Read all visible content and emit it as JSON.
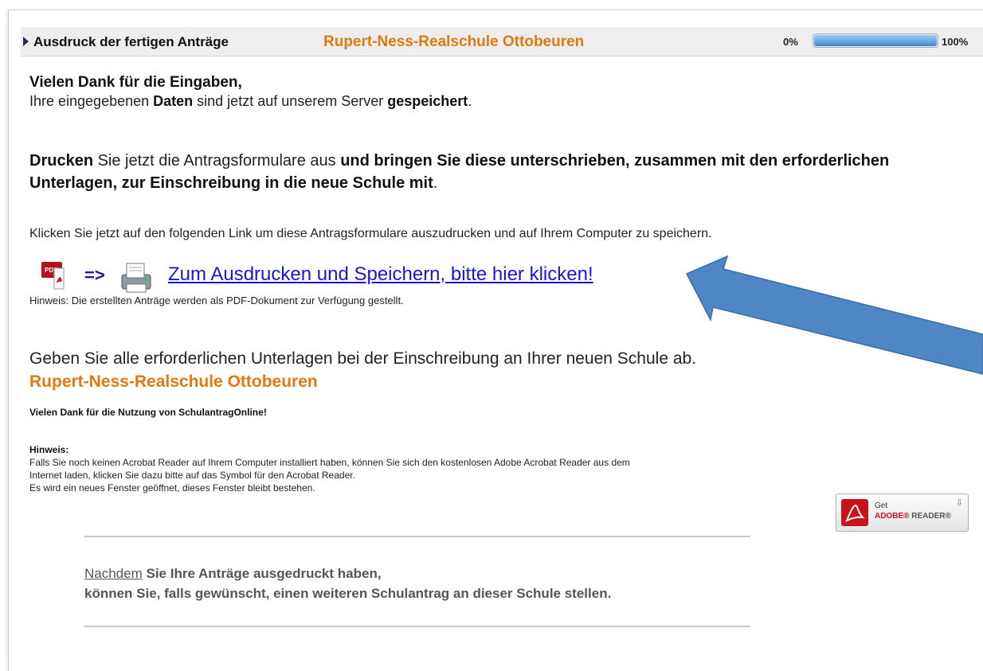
{
  "header": {
    "title": "Ausdruck der fertigen Anträge",
    "school": "Rupert-Ness-Realschule Ottobeuren",
    "progress_min": "0%",
    "progress_max": "100%",
    "progress_fraction": 1.0
  },
  "thanks": {
    "heading": "Vielen Dank für die Eingaben,",
    "line_pre": "Ihre eingegebenen ",
    "line_b1": "Daten",
    "line_mid": " sind jetzt auf unserem Server ",
    "line_b2": "gespeichert",
    "line_end": "."
  },
  "print": {
    "b1": "Drucken",
    "mid": " Sie jetzt die Antragsformulare aus ",
    "b2": "und bringen Sie diese unterschrieben, zusammen mit den erforderlichen Unterlagen, zur Einschreibung in die neue Schule mit",
    "end": "."
  },
  "click_instruction": "Klicken Sie jetzt auf den folgenden Link um diese Antragsformulare auszudrucken und auf Ihrem Computer zu speichern.",
  "download": {
    "arrow": "=>",
    "link_label": "Zum Ausdrucken und Speichern, bitte hier klicken!",
    "pdf_icon_text": "PDF"
  },
  "pdf_hint": "Hinweis: Die erstellten Anträge werden als PDF-Dokument zur Verfügung gestellt.",
  "submit_text": "Geben Sie alle erforderlichen Unterlagen bei der Einschreibung an Ihrer neuen Schule ab.",
  "school_name": "Rupert-Ness-Realschule Ottobeuren",
  "usage_thanks": "Vielen Dank für die Nutzung von SchulantragOnline!",
  "hinweis": {
    "heading": "Hinweis:",
    "line1": "Falls Sie noch keinen Acrobat Reader auf Ihrem Computer installiert haben, können Sie sich den kostenlosen Adobe Acrobat Reader aus dem",
    "line2": "Internet laden, klicken Sie dazu bitte auf das Symbol für den Acrobat Reader.",
    "line3": "Es wird ein neues Fenster geöffnet, dieses Fenster bleibt bestehen."
  },
  "adobe": {
    "get": "Get",
    "brand": "ADOBE®",
    "product": " READER®"
  },
  "after": {
    "link": "Nachdem",
    "line1_rest": " Sie Ihre Anträge ausgedruckt haben,",
    "line2": "können Sie, falls gewünscht, einen weiteren Schulantrag an dieser Schule stellen."
  },
  "colors": {
    "accent_orange": "#e07a10",
    "link_blue": "#1717d6",
    "callout_arrow": "#4f86c6",
    "adobe_red": "#c8131b"
  }
}
